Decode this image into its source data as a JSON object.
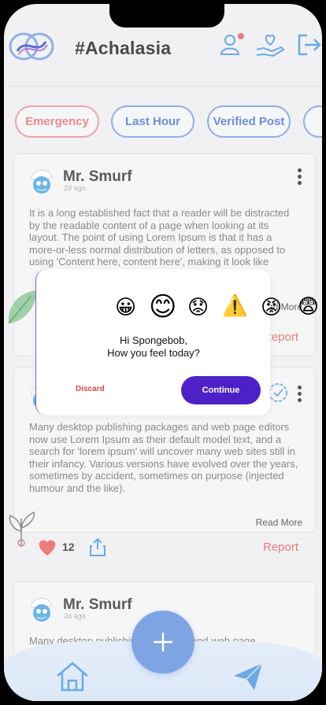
{
  "header": {
    "title": "#Achalasia"
  },
  "filters": [
    {
      "label": "Emergency"
    },
    {
      "label": "Last Hour"
    },
    {
      "label": "Verified Post"
    }
  ],
  "posts": [
    {
      "author": "Mr. Smurf",
      "time": "2d ago",
      "text": "It is a long established fact that a reader will be distracted by the readable content of a page when looking at its layout. The point of using Lorem Ipsum is that it has a more-or-less normal distribution of letters, as opposed to using 'Content here, content here', making it look like readable English.",
      "read_more": "Read More",
      "report": "Report"
    },
    {
      "text": "Many desktop publishing packages and web page editors now use Lorem Ipsum as their default model text, and a search for 'lorem ipsum' will uncover many web sites still in their infancy. Various versions have evolved over the years, sometimes by accident, sometimes on purpose (injected humour and the like).",
      "read_more": "Read More",
      "likes": "12",
      "report": "Report"
    },
    {
      "author": "Mr. Smurf",
      "time": "2d ago",
      "text": "Many desktop publishing packages and web page"
    }
  ],
  "modal": {
    "emojis": [
      "😀",
      "😊",
      "😟",
      "⚠️",
      "😡",
      "😨"
    ],
    "greeting_line1": "Hi Spongebob,",
    "greeting_line2": "How you feel today?",
    "discard_label": "Discard",
    "continue_label": "Continue"
  },
  "icons": {
    "logo": "infinity-logo-icon",
    "profile": "user-profile-icon",
    "care": "heart-hand-icon",
    "logout": "logout-icon",
    "home": "home-icon",
    "send": "send-icon",
    "add": "plus-icon"
  },
  "colors": {
    "accent": "#4d21c7",
    "primary_blue": "#7ea4e3",
    "emergency": "#ea8c8c"
  }
}
